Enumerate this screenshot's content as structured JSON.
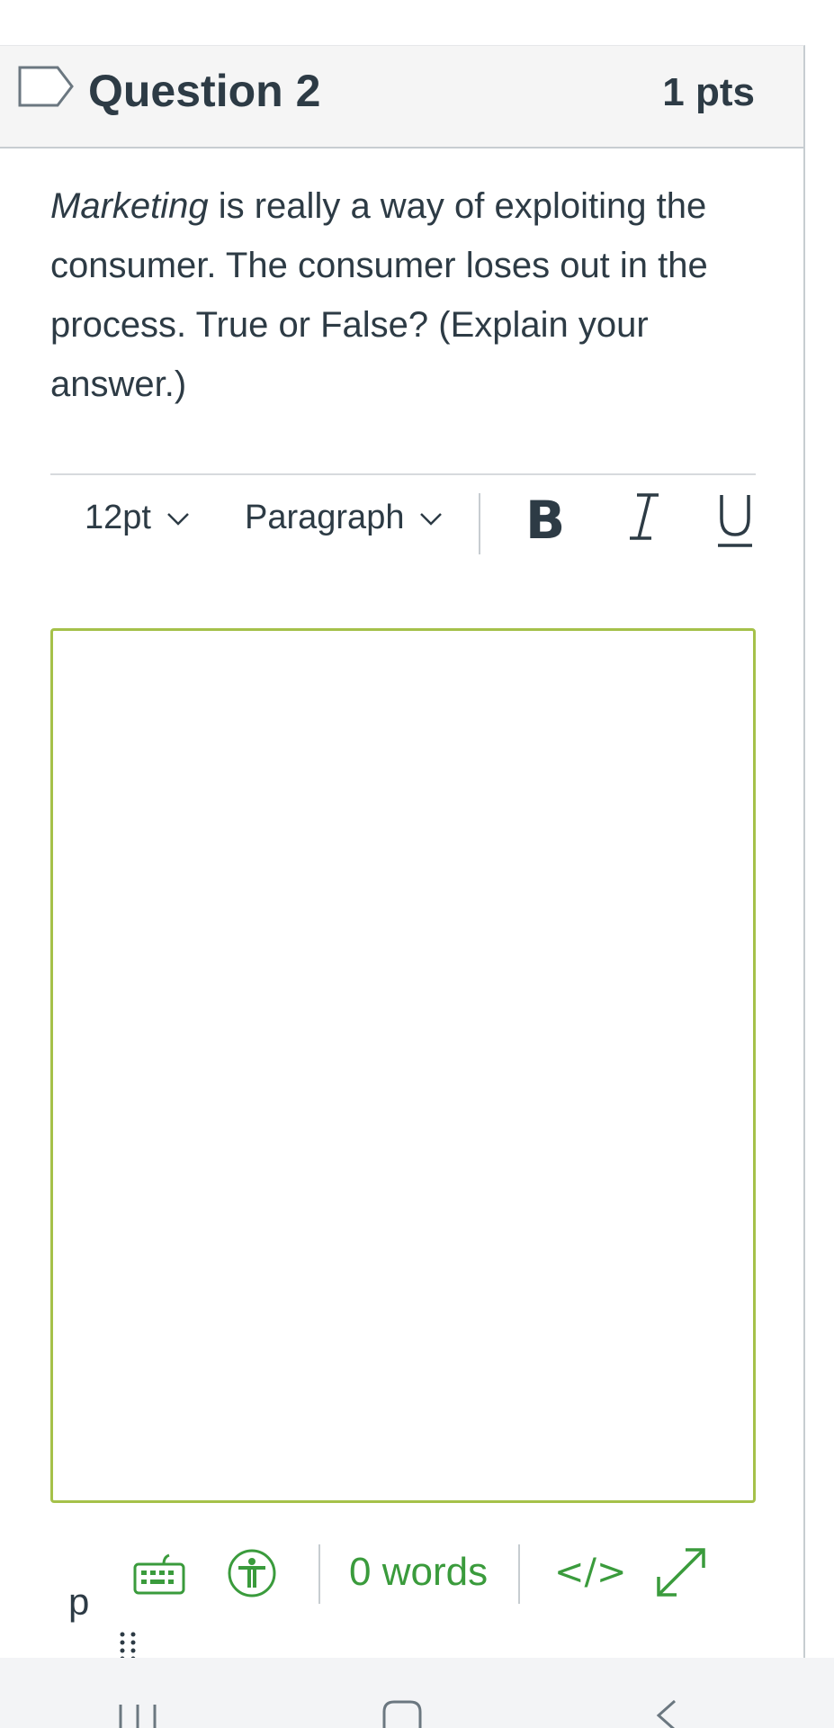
{
  "question": {
    "title": "Question 2",
    "points": "1 pts",
    "text_emphasis": "Marketing",
    "text_rest": " is really a way of exploiting the consumer. The consumer loses out in the process. True or False? (Explain your answer.)"
  },
  "toolbar": {
    "font_size": "12pt",
    "block_format": "Paragraph",
    "bold_label": "B"
  },
  "editor": {
    "content": ""
  },
  "statusbar": {
    "path": "p",
    "word_count": "0 words",
    "html_toggle": "</>"
  },
  "colors": {
    "accent_green": "#3a9b3c",
    "editor_border": "#a5c14a",
    "text": "#2d3b45"
  },
  "icons": {
    "flag": "bookmark-flag-icon",
    "keyboard": "keyboard-icon",
    "accessibility": "accessibility-checker-icon",
    "fullscreen": "fullscreen-icon",
    "resize": "resize-handle-icon",
    "nav_recents": "recents-icon",
    "nav_home": "home-icon",
    "nav_back": "back-icon"
  }
}
